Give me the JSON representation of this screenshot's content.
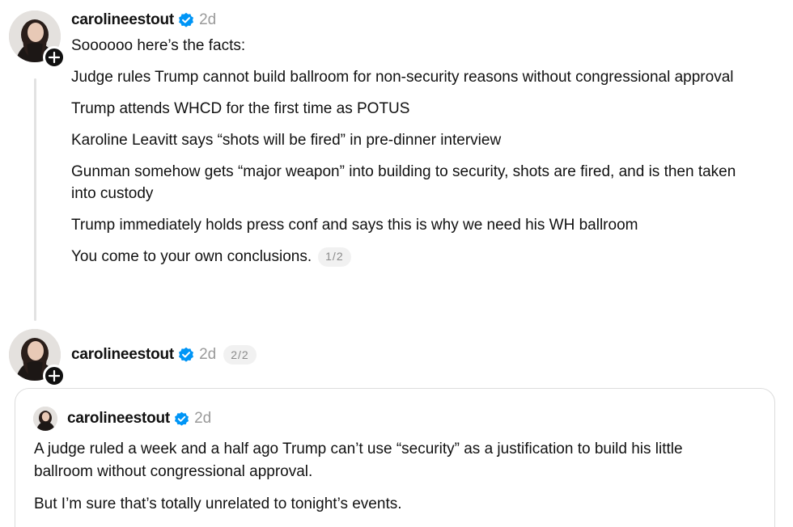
{
  "posts": [
    {
      "username": "carolineestout",
      "time": "2d",
      "paragraphs": [
        "Soooooo here’s the facts:",
        "Judge rules Trump cannot build ballroom for non-security reasons without congressional approval",
        "Trump attends WHCD for the first time as POTUS",
        "Karoline Leavitt says “shots will be fired” in pre-dinner interview",
        "Gunman somehow gets “major weapon” into building to security, shots are fired,  and is then taken into custody",
        "Trump immediately holds press conf and says this is why we need his WH ballroom"
      ],
      "last_paragraph": "You come to your own conclusions.",
      "pager": "1/2"
    },
    {
      "username": "carolineestout",
      "time": "2d",
      "pager": "2/2"
    }
  ],
  "quote": {
    "username": "carolineestout",
    "time": "2d",
    "paragraphs": [
      "A judge ruled a week and a half ago Trump can’t use “security” as a justification to build his little ballroom without congressional approval.",
      "But I’m sure that’s totally unrelated to tonight’s events."
    ]
  },
  "icons": {
    "verified": "verified-badge-icon",
    "follow": "plus-icon"
  },
  "colors": {
    "verified_blue": "#0095f6",
    "timestamp_gray": "#9a9a9a",
    "badge_black": "#101010"
  }
}
